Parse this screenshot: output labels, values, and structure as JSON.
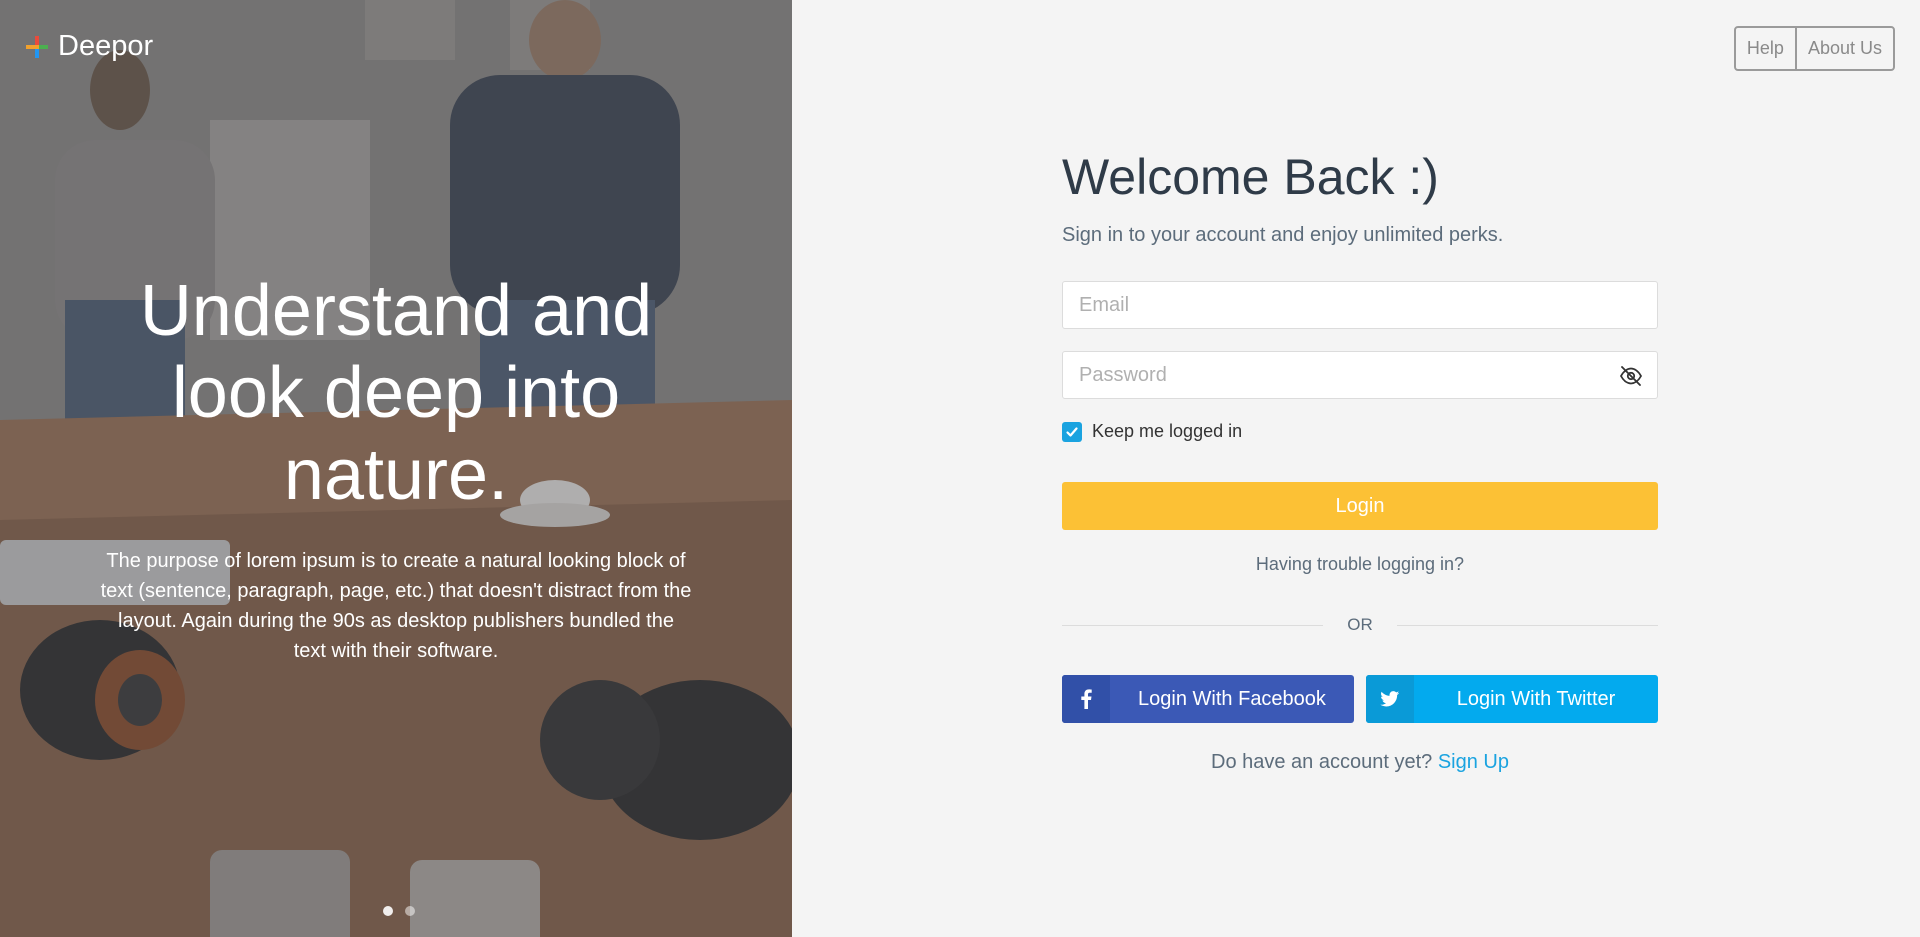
{
  "brand": {
    "name": "Deepor",
    "logo_icon": "deepor-logo-icon"
  },
  "hero": {
    "title": "Understand and look deep into nature.",
    "description": "The purpose of lorem ipsum is to create a natural looking block of text (sentence, paragraph, page, etc.) that doesn't distract from the layout. Again during the 90s as desktop publishers bundled the text with their software.",
    "carousel": {
      "slides": 2,
      "active": 1
    }
  },
  "top_nav": {
    "help": "Help",
    "about": "About Us"
  },
  "login": {
    "title": "Welcome Back :)",
    "subtitle": "Sign in to your account and enjoy unlimited perks.",
    "email_placeholder": "Email",
    "password_placeholder": "Password",
    "remember_label": "Keep me logged in",
    "remember_checked": true,
    "login_button": "Login",
    "trouble_link": "Having trouble logging in?",
    "or_text": "OR",
    "facebook_button": "Login With Facebook",
    "twitter_button": "Login With Twitter",
    "signup_prompt": "Do have an account yet?",
    "signup_link": "Sign Up"
  },
  "colors": {
    "login_button": "#fcc135",
    "facebook": "#3b59b6",
    "twitter": "#03aaee",
    "link": "#1aa3e0",
    "heading": "#2f3b48"
  }
}
